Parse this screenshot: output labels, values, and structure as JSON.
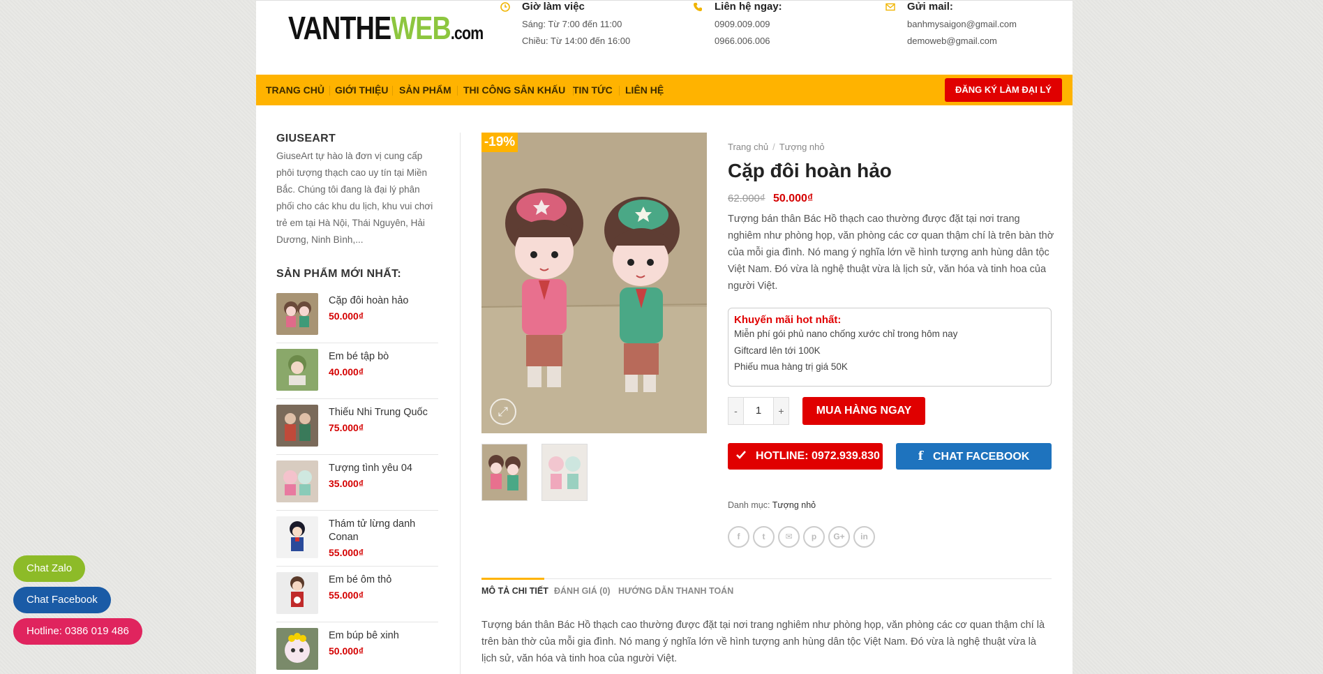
{
  "header": {
    "logo": {
      "part1": "VANTHE",
      "part2": "WEB",
      "part3": ".com"
    },
    "hours": {
      "title": "Giờ làm việc",
      "line1": "Sáng: Từ 7:00 đến 11:00",
      "line2": "Chiều: Từ 14:00 đến 16:00"
    },
    "contact": {
      "title": "Liên hệ ngay:",
      "line1": "0909.009.009",
      "line2": "0966.006.006"
    },
    "email": {
      "title": "Gửi mail:",
      "line1": "banhmysaigon@gmail.com",
      "line2": "demoweb@gmail.com"
    }
  },
  "nav": {
    "items": [
      "TRANG CHỦ",
      "GIỚI THIỆU",
      "SẢN PHẨM",
      "THI CÔNG SÂN KHẤU",
      "TIN TỨC",
      "LIÊN HỆ"
    ],
    "cta": "ĐĂNG KÝ LÀM ĐẠI LÝ"
  },
  "sidebar": {
    "about_title": "GIUSEART",
    "about_text": "GiuseArt tự hào là đơn vị cung cấp phôi tượng thạch cao uy tín tại Miền Bắc. Chúng tôi đang là đại lý phân phối cho các khu du lịch, khu vui chơi trẻ em tại Hà Nội, Thái Nguyên, Hải Dương, Ninh Bình,...",
    "new_title": "SẢN PHẨM MỚI NHẤT:",
    "products": [
      {
        "name": "Cặp đôi hoàn hảo",
        "price": "50.000₫"
      },
      {
        "name": "Em bé tập bò",
        "price": "40.000₫"
      },
      {
        "name": "Thiếu Nhi Trung Quốc",
        "price": "75.000₫"
      },
      {
        "name": "Tượng tình yêu 04",
        "price": "35.000₫"
      },
      {
        "name": "Thám tử lừng danh Conan",
        "price": "55.000₫"
      },
      {
        "name": "Em bé ôm thỏ",
        "price": "55.000₫"
      },
      {
        "name": "Em búp bê xinh",
        "price": "50.000₫"
      }
    ]
  },
  "product": {
    "badge": "-19%",
    "breadcrumb": {
      "home": "Trang chủ",
      "sep": "/",
      "category": "Tượng nhỏ"
    },
    "title": "Cặp đôi hoàn hảo",
    "old_price": "62.000₫",
    "price": "50.000₫",
    "short_desc": "Tượng bán thân Bác Hồ thạch cao thường được đặt tại nơi trang nghiêm như phòng họp, văn phòng các cơ quan thậm chí là trên bàn thờ của mỗi gia đình. Nó mang ý nghĩa lớn về hình tượng anh hùng dân tộc Việt Nam. Đó vừa là nghệ thuật vừa là lịch sử, văn hóa và tinh hoa của người Việt.",
    "promo": {
      "title": "Khuyến mãi hot nhất:",
      "lines": [
        "Miễn phí gói phủ nano chống xước chỉ trong hôm nay",
        "Giftcard lên tới 100K",
        "Phiếu mua hàng trị giá 50K"
      ]
    },
    "qty": {
      "minus": "-",
      "value": "1",
      "plus": "+"
    },
    "buy": "MUA HÀNG NGAY",
    "hotline": "HOTLINE: 0972.939.830",
    "facebook": "CHAT FACEBOOK",
    "category_label": "Danh mục:",
    "category_value": "Tượng nhỏ",
    "share_icons": [
      "f",
      "t",
      "✉",
      "p",
      "G+",
      "in"
    ]
  },
  "tabs": {
    "items": [
      "MÔ TẢ CHI TIẾT",
      "ĐÁNH GIÁ (0)",
      "HƯỚNG DẪN THANH TOÁN"
    ],
    "description": "Tượng bán thân Bác Hồ thạch cao thường được đặt tại nơi trang nghiêm như phòng họp, văn phòng các cơ quan thậm chí là trên bàn thờ của mỗi gia đình. Nó mang ý nghĩa lớn về hình tượng anh hùng dân tộc Việt Nam. Đó vừa là nghệ thuật vừa là lịch sử, văn hóa và tinh hoa của người Việt."
  },
  "floating": {
    "zalo": "Chat Zalo",
    "facebook": "Chat Facebook",
    "hotline": "Hotline: 0386 019 486"
  },
  "colors": {
    "nav_bg": "#ffb300",
    "accent_red": "#e00000",
    "price_red": "#d40000",
    "facebook_blue": "#1e73be",
    "zalo_green": "#8dbb28",
    "hotline_pink": "#e0245e",
    "chat_fb_blue": "#1a5ba6"
  },
  "icons": {
    "hours": "clock-icon",
    "contact": "phone-icon",
    "email": "envelope-icon",
    "zoom": "expand-icon",
    "hotline": "check-icon",
    "facebook": "facebook-icon"
  }
}
